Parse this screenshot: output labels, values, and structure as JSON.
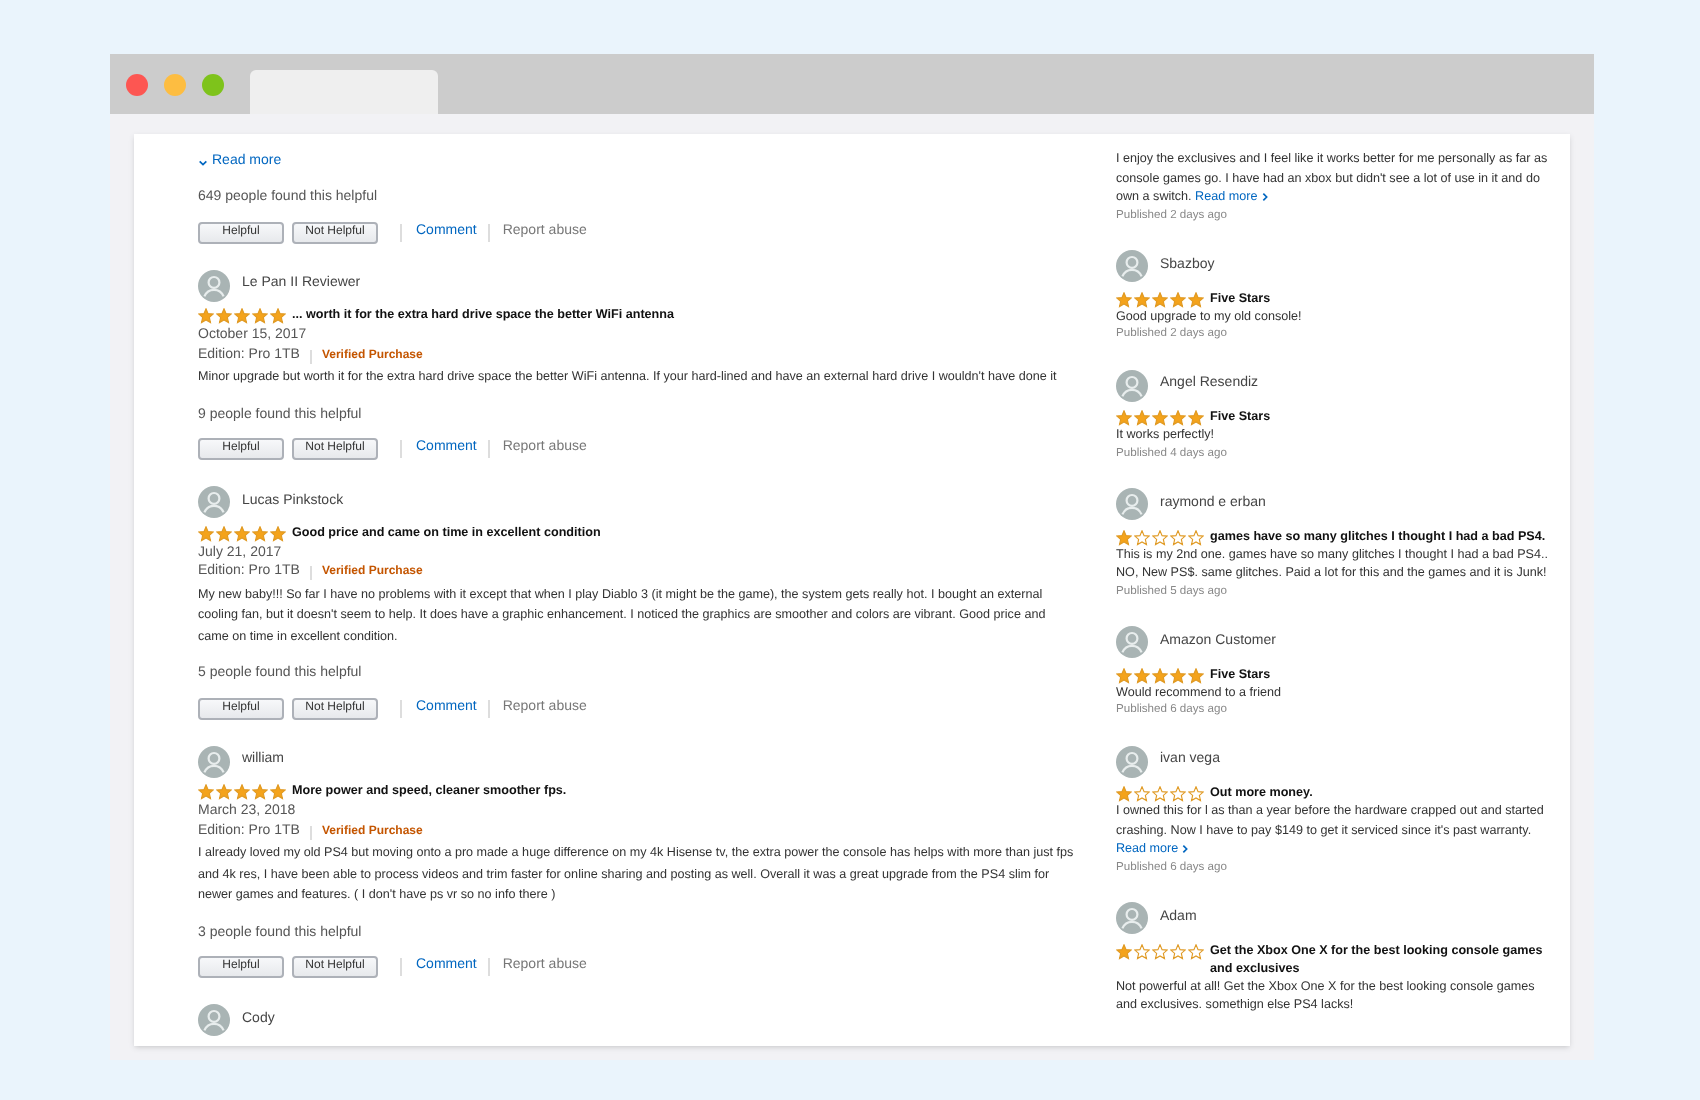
{
  "left": {
    "top_fragment": {
      "read_more": "Read more",
      "helpful_count": "649 people found this helpful",
      "buttons": [
        "Helpful",
        "Not Helpful"
      ],
      "links": [
        "Comment",
        "Report abuse"
      ]
    },
    "reviews": [
      {
        "author": "Le Pan II Reviewer",
        "stars": 5,
        "title": "... worth it for the extra hard drive space the better WiFi antenna",
        "date": "October 15, 2017",
        "edition": "Edition: Pro 1TB",
        "badge": "Verified Purchase",
        "body": "Minor upgrade but worth it for the extra hard drive space the better WiFi antenna. If your hard-lined and have an external hard drive I wouldn't have done it",
        "helpful_count": "9 people found this helpful",
        "buttons": [
          "Helpful",
          "Not Helpful"
        ],
        "links": [
          "Comment",
          "Report abuse"
        ]
      },
      {
        "author": "Lucas Pinkstock",
        "stars": 5,
        "title": "Good price and came on time in excellent condition",
        "date": "July 21, 2017",
        "edition": "Edition: Pro 1TB",
        "badge": "Verified Purchase",
        "body": "My new baby!!! So far I have no problems with it except that when I play Diablo 3 (it might be the game), the system gets really hot. I bought an external cooling fan, but it doesn't seem to help. It does have a graphic enhancement. I noticed the graphics are smoother and colors are vibrant. Good price and came on time in excellent condition.",
        "helpful_count": "5 people found this helpful",
        "buttons": [
          "Helpful",
          "Not Helpful"
        ],
        "links": [
          "Comment",
          "Report abuse"
        ]
      },
      {
        "author": "william",
        "stars": 5,
        "title": "More power and speed, cleaner smoother fps.",
        "date": "March 23, 2018",
        "edition": "Edition: Pro 1TB",
        "badge": "Verified Purchase",
        "body": "I already loved my old PS4 but moving onto a pro made a huge difference on my 4k Hisense tv, the extra power the console has helps with more than just fps and 4k res, I have been able to process videos and trim faster for online sharing and posting as well. Overall it was a great upgrade from the PS4 slim for newer games and features. ( I don't have ps vr so no info there )",
        "helpful_count": "3 people found this helpful",
        "buttons": [
          "Helpful",
          "Not Helpful"
        ],
        "links": [
          "Comment",
          "Report abuse"
        ]
      },
      {
        "author": "Cody"
      }
    ]
  },
  "right": {
    "reviews": [
      {
        "body": "I enjoy the exclusives and I feel like it works better for me personally as far as console games go. I have had an xbox but didn't see a lot of use in it and do own a switch.",
        "read_more": "Read more",
        "published": "Published 2 days ago"
      },
      {
        "author": "Sbazboy",
        "stars": 5,
        "title": "Five Stars",
        "body": "Good upgrade to my old console!",
        "published": "Published 2 days ago"
      },
      {
        "author": "Angel Resendiz",
        "stars": 5,
        "title": "Five Stars",
        "body": "It works perfectly!",
        "published": "Published 4 days ago"
      },
      {
        "author": "raymond e erban",
        "stars": 1,
        "title": "games have so many glitches I thought I had a bad PS4.",
        "body": "This is my 2nd one. games have so many glitches I thought I had a bad PS4.. NO, New PS$. same glitches. Paid a lot for this and the games and it is Junk!",
        "published": "Published 5 days ago"
      },
      {
        "author": "Amazon Customer",
        "stars": 5,
        "title": "Five Stars",
        "body": "Would recommend to a friend",
        "published": "Published 6 days ago"
      },
      {
        "author": "ivan vega",
        "stars": 1,
        "title": "Out more money.",
        "body": "I owned this for l as than a year before the hardware crapped out and started crashing. Now I have to pay $149 to get it serviced since it's past warranty.",
        "read_more": "Read more",
        "published": "Published 6 days ago"
      },
      {
        "author": "Adam",
        "stars": 1,
        "title": "Get the Xbox One X for the best looking console games and exclusives",
        "body": "Not powerful at all! Get the Xbox One X for the best looking console games and exclusives. somethign else PS4 lacks!"
      }
    ]
  }
}
